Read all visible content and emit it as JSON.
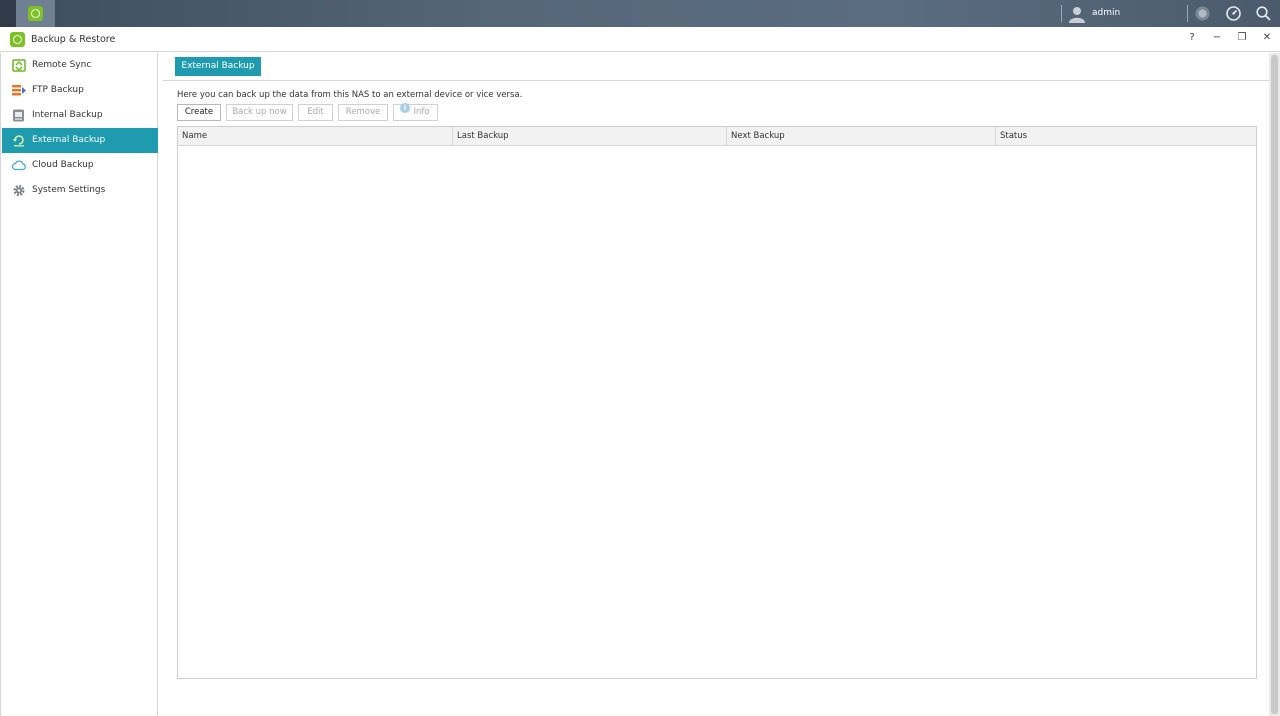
{
  "taskbar": {
    "username": "admin"
  },
  "window": {
    "title": "Backup & Restore",
    "controls": {
      "help": "?",
      "minimize": "−",
      "restore": "❐",
      "close": "✕"
    }
  },
  "sidebar": {
    "items": [
      {
        "label": "Remote Sync",
        "icon": "remote-sync-icon"
      },
      {
        "label": "FTP Backup",
        "icon": "ftp-backup-icon"
      },
      {
        "label": "Internal Backup",
        "icon": "internal-backup-icon"
      },
      {
        "label": "External Backup",
        "icon": "external-backup-icon",
        "active": true
      },
      {
        "label": "Cloud Backup",
        "icon": "cloud-icon"
      },
      {
        "label": "System Settings",
        "icon": "gear-icon"
      }
    ]
  },
  "main": {
    "tab_label": "External Backup",
    "description": "Here you can back up the data from this NAS to an external device or vice versa.",
    "toolbar": {
      "create": "Create",
      "back_up_now": "Back up now",
      "edit": "Edit",
      "remove": "Remove",
      "info": "Info",
      "info_glyph": "i"
    },
    "table": {
      "columns": [
        "Name",
        "Last Backup",
        "Next Backup",
        "Status"
      ]
    }
  },
  "colors": {
    "accent": "#1f9bb0",
    "app_green": "#7cc225"
  }
}
